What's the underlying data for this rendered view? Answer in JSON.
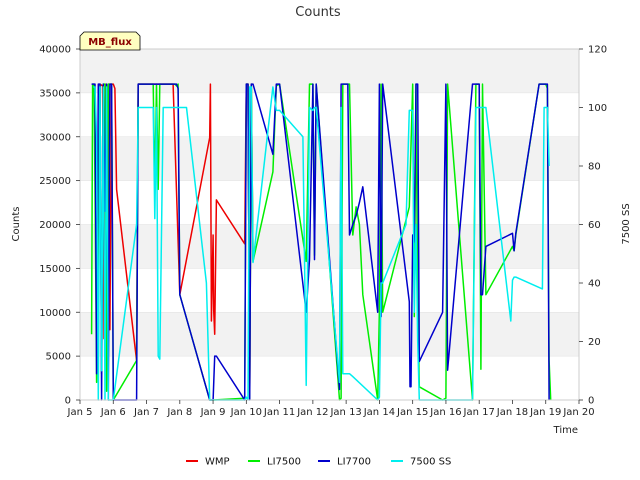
{
  "chart_data": {
    "type": "line",
    "title": "Counts",
    "xlabel": "Time",
    "ylabel": "Counts",
    "y2label": "7500 SS",
    "badge": "MB_flux",
    "xlim": [
      5,
      20
    ],
    "ylim": [
      0,
      40000
    ],
    "y2lim": [
      0,
      120
    ],
    "x_ticks": [
      5,
      6,
      7,
      8,
      9,
      10,
      11,
      12,
      13,
      14,
      15,
      16,
      17,
      18,
      19,
      20
    ],
    "x_tick_labels": [
      "Jan 5",
      "Jan 6",
      "Jan 7",
      "Jan 8",
      "Jan 9",
      "Jan 10",
      "Jan 11",
      "Jan 12",
      "Jan 13",
      "Jan 14",
      "Jan 15",
      "Jan 16",
      "Jan 17",
      "Jan 18",
      "Jan 19",
      "Jan 20"
    ],
    "y_ticks": [
      0,
      5000,
      10000,
      15000,
      20000,
      25000,
      30000,
      35000,
      40000
    ],
    "y2_ticks": [
      0,
      20,
      40,
      60,
      80,
      100,
      120
    ],
    "grid": "horizontal bands",
    "legend_position": "bottom",
    "series": [
      {
        "name": "WMP",
        "color": "#ee0000",
        "axis": "left",
        "x": [
          5.6,
          5.68,
          5.72,
          5.76,
          5.8,
          5.85,
          5.9,
          5.95,
          6.0,
          6.05,
          6.1,
          6.7,
          6.75,
          6.8,
          7.0,
          7.1,
          7.2,
          7.3,
          7.4,
          7.6,
          7.8,
          8.0,
          8.9,
          8.92,
          8.95,
          9.0,
          9.02,
          9.05,
          9.1,
          9.15,
          9.95,
          10.0,
          10.05,
          10.1,
          10.15,
          10.2
        ],
        "y": [
          36000,
          35800,
          7000,
          36000,
          5000,
          36000,
          8000,
          36000,
          36000,
          35500,
          24000,
          4500,
          36000,
          36000,
          36000,
          36000,
          36000,
          36000,
          36000,
          36000,
          36000,
          12000,
          29900,
          36000,
          9000,
          18800,
          10200,
          7500,
          22800,
          22500,
          17800,
          36000,
          36000,
          200,
          36000,
          16000
        ]
      },
      {
        "name": "LI7500",
        "color": "#00ee00",
        "axis": "left",
        "x": [
          5.35,
          5.38,
          5.42,
          5.45,
          5.5,
          5.6,
          5.65,
          5.7,
          5.75,
          5.8,
          5.85,
          5.9,
          5.95,
          6.0,
          6.7,
          6.75,
          6.8,
          7.0,
          7.2,
          7.25,
          7.3,
          7.35,
          7.4,
          7.6,
          7.85,
          7.9,
          7.95,
          8.0,
          8.9,
          9.0,
          9.95,
          10.0,
          10.05,
          10.1,
          10.15,
          10.2,
          10.8,
          10.9,
          11.0,
          11.8,
          11.9,
          12.0,
          12.05,
          12.1,
          12.8,
          12.85,
          12.9,
          12.95,
          13.0,
          13.05,
          13.1,
          13.2,
          13.3,
          13.4,
          13.5,
          13.95,
          14.0,
          14.05,
          14.1,
          14.9,
          15.0,
          15.05,
          15.1,
          15.15,
          15.2,
          15.9,
          16.0,
          16.05,
          16.8,
          16.9,
          16.95,
          17.0,
          17.05,
          17.1,
          17.2,
          18.0,
          18.05,
          18.1,
          18.8,
          18.9,
          18.95,
          19.0,
          19.05,
          19.1,
          19.15
        ],
        "y": [
          7500,
          36000,
          36000,
          24000,
          2000,
          36000,
          3000,
          36000,
          36000,
          1000,
          36000,
          36000,
          36000,
          0,
          4500,
          36000,
          36000,
          36000,
          36000,
          24000,
          36000,
          24000,
          36000,
          36000,
          36000,
          35800,
          36000,
          12000,
          0,
          0,
          200,
          36000,
          36000,
          200,
          36000,
          15800,
          26000,
          35800,
          36000,
          15800,
          36000,
          36000,
          16500,
          36000,
          0,
          200,
          36000,
          36000,
          36000,
          36000,
          36000,
          18800,
          22000,
          20000,
          12000,
          0,
          10300,
          36000,
          10000,
          22000,
          36000,
          9500,
          36000,
          11000,
          1500,
          0,
          200,
          36000,
          0,
          36000,
          36000,
          36000,
          3500,
          36000,
          12000,
          17500,
          17000,
          18800,
          36000,
          36000,
          36000,
          36000,
          35500,
          4500,
          0
        ]
      },
      {
        "name": "LI7700",
        "color": "#0000cc",
        "axis": "left",
        "x": [
          5.35,
          5.38,
          5.45,
          5.5,
          5.55,
          5.6,
          5.65,
          5.7,
          5.75,
          5.8,
          5.85,
          5.9,
          5.95,
          6.0,
          6.7,
          6.75,
          7.0,
          7.5,
          7.6,
          7.9,
          7.95,
          8.0,
          8.9,
          9.0,
          9.05,
          9.1,
          9.95,
          10.0,
          10.05,
          10.1,
          10.15,
          10.2,
          10.8,
          10.9,
          11.0,
          11.8,
          11.9,
          12.0,
          12.05,
          12.1,
          12.8,
          12.85,
          12.9,
          12.95,
          13.0,
          13.05,
          13.1,
          13.2,
          13.3,
          13.4,
          13.5,
          13.95,
          14.0,
          14.05,
          14.1,
          14.9,
          14.92,
          14.95,
          15.0,
          15.05,
          15.1,
          15.15,
          15.2,
          15.9,
          16.0,
          16.05,
          16.8,
          16.9,
          16.95,
          17.0,
          17.05,
          17.1,
          17.2,
          18.0,
          18.05,
          18.1,
          18.8,
          18.9,
          18.95,
          19.0,
          19.05,
          19.1
        ],
        "y": [
          36000,
          36000,
          36000,
          3000,
          36000,
          36000,
          0,
          36000,
          21500,
          36000,
          0,
          36000,
          36000,
          0,
          0,
          36000,
          36000,
          36000,
          36000,
          36000,
          35500,
          12000,
          0,
          0,
          5000,
          5000,
          0,
          36000,
          36000,
          0,
          36000,
          36000,
          28000,
          36000,
          36000,
          10000,
          16000,
          36000,
          16000,
          36000,
          1200,
          36000,
          36000,
          36000,
          36000,
          36000,
          18800,
          20000,
          21000,
          22500,
          24300,
          10000,
          36000,
          9500,
          36000,
          11200,
          1500,
          1500,
          18800,
          18000,
          36000,
          36000,
          4400,
          10000,
          36000,
          3400,
          36000,
          36000,
          36000,
          36000,
          12000,
          12000,
          17500,
          19000,
          17000,
          19000,
          36000,
          36000,
          36000,
          36000,
          36000,
          0
        ]
      },
      {
        "name": "7500 SS",
        "color": "#00eeee",
        "axis": "right",
        "x": [
          5.4,
          5.45,
          5.5,
          5.55,
          5.6,
          5.65,
          5.7,
          5.75,
          5.8,
          5.85,
          6.0,
          6.7,
          6.75,
          6.85,
          7.0,
          7.1,
          7.2,
          7.25,
          7.3,
          7.35,
          7.4,
          7.5,
          7.6,
          7.8,
          7.9,
          8.0,
          8.1,
          8.2,
          8.8,
          8.9,
          9.0,
          9.05,
          9.1,
          9.95,
          10.0,
          10.05,
          10.1,
          10.15,
          10.2,
          10.8,
          10.9,
          11.0,
          11.7,
          11.8,
          11.9,
          12.0,
          12.05,
          12.1,
          12.8,
          12.85,
          12.9,
          12.95,
          13.0,
          13.1,
          13.2,
          13.95,
          14.0,
          14.05,
          14.1,
          14.8,
          14.9,
          15.0,
          15.05,
          15.1,
          15.15,
          15.2,
          15.9,
          16.0,
          16.05,
          16.8,
          16.9,
          16.95,
          17.0,
          17.05,
          17.1,
          17.2,
          17.95,
          18.0,
          18.05,
          18.1,
          18.9,
          18.95,
          19.0,
          19.05,
          19.1
        ],
        "y": [
          107,
          107,
          90,
          0,
          107,
          10,
          107,
          0,
          107,
          0,
          0,
          60,
          100,
          100,
          100,
          100,
          100,
          62,
          100,
          15,
          14,
          100,
          100,
          100,
          100,
          100,
          100,
          100,
          40,
          0,
          0,
          0,
          0,
          0,
          1,
          0,
          107,
          107,
          47,
          107,
          99,
          99,
          90,
          5,
          100,
          99,
          100,
          100,
          6,
          100,
          9,
          9,
          9,
          9,
          8,
          0,
          1,
          40,
          40,
          60,
          99,
          99,
          30,
          60,
          20,
          0,
          0,
          0,
          0,
          0,
          100,
          100,
          100,
          100,
          100,
          100,
          27,
          41,
          42,
          42,
          38,
          100,
          100,
          100,
          80
        ]
      }
    ]
  }
}
